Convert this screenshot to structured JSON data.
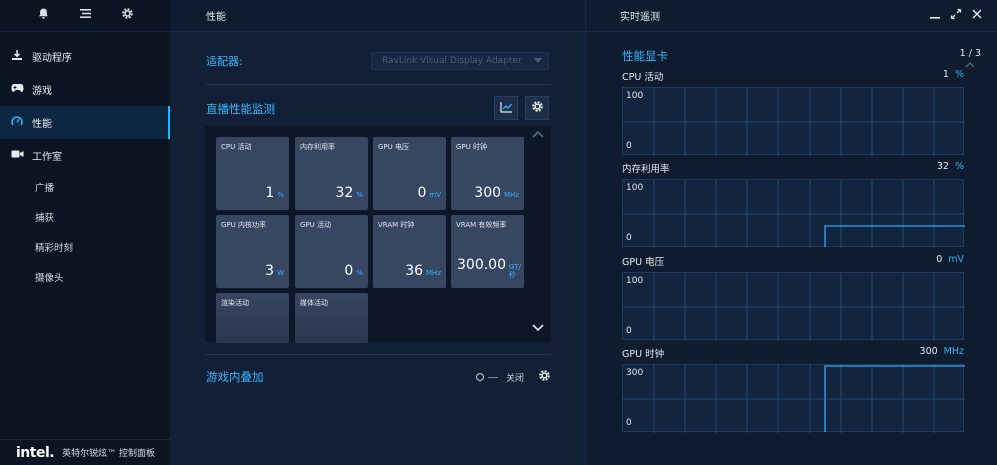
{
  "sidebar": {
    "top_icons": [
      "bell-icon",
      "list-icon",
      "gear-icon"
    ],
    "items": [
      {
        "label": "驱动程序",
        "icon": "download-icon",
        "active": false
      },
      {
        "label": "游戏",
        "icon": "gamepad-icon",
        "active": false
      },
      {
        "label": "性能",
        "icon": "gauge-icon",
        "active": true
      },
      {
        "label": "工作室",
        "icon": "camera-icon",
        "active": false
      }
    ],
    "sub_items": [
      "广播",
      "捕获",
      "精彩时刻",
      "摄像头"
    ],
    "footer": {
      "logo": "intel.",
      "product": "英特尔锐炫™ 控制面板"
    }
  },
  "performance": {
    "header": "性能",
    "adapter_label": "适配器:",
    "adapter_value": "RavLink Visual Display Adapter",
    "monitor_title": "直播性能监测",
    "tiles": [
      {
        "label": "CPU 活动",
        "value": "1",
        "unit": "%"
      },
      {
        "label": "内存利用率",
        "value": "32",
        "unit": "%"
      },
      {
        "label": "GPU 电压",
        "value": "0",
        "unit": "mV"
      },
      {
        "label": "GPU 时钟",
        "value": "300",
        "unit": "MHz"
      },
      {
        "label": "GPU 内核功率",
        "value": "3",
        "unit": "W"
      },
      {
        "label": "GPU 活动",
        "value": "0",
        "unit": "%"
      },
      {
        "label": "VRAM 时钟",
        "value": "36",
        "unit": "MHz"
      },
      {
        "label": "VRAM 有效频率",
        "value": "300.00",
        "unit": "GT/秒"
      },
      {
        "label": "渲染活动",
        "value": "",
        "unit": ""
      },
      {
        "label": "媒体活动",
        "value": "",
        "unit": ""
      }
    ],
    "overlay_title": "游戏内叠加",
    "overlay_state": "关闭"
  },
  "telemetry": {
    "header": "实时遥测",
    "title": "性能显卡",
    "page": "1 / 3",
    "metrics": [
      {
        "name": "CPU 活动",
        "value": "1",
        "unit": "%",
        "max": "100",
        "min": "0",
        "step_at": null,
        "level": 0
      },
      {
        "name": "内存利用率",
        "value": "32",
        "unit": "%",
        "max": "100",
        "min": "0",
        "step_at": 0.59,
        "level": 0.32
      },
      {
        "name": "GPU 电压",
        "value": "0",
        "unit": "mV",
        "max": "100",
        "min": "0",
        "step_at": null,
        "level": 0
      },
      {
        "name": "GPU 时钟",
        "value": "300",
        "unit": "MHz",
        "max": "300",
        "min": "0",
        "step_at": 0.59,
        "level": 1
      }
    ]
  },
  "colors": {
    "accent": "#2bb5ff",
    "grid": "#1f4a78",
    "line": "#2fa8ff"
  }
}
